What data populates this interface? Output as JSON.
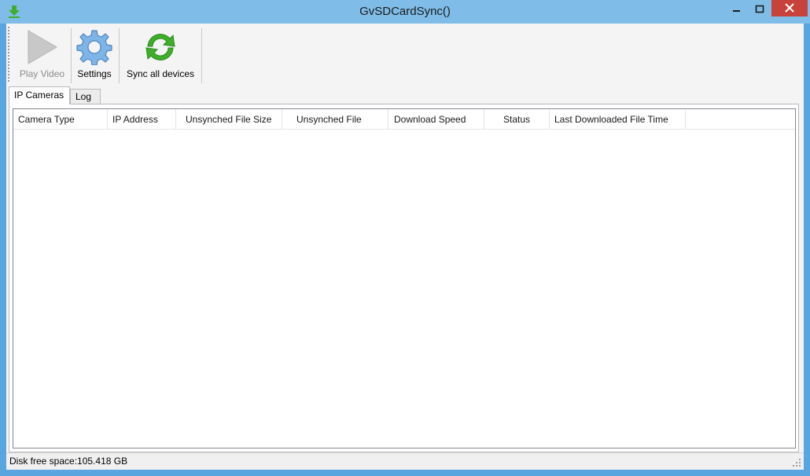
{
  "window": {
    "title": "GvSDCardSync()",
    "icon": "download-arrow-icon"
  },
  "toolbar": {
    "buttons": [
      {
        "label": "Play Video",
        "icon": "play-icon",
        "enabled": false
      },
      {
        "label": "Settings",
        "icon": "gear-icon",
        "enabled": true
      },
      {
        "label": "Sync all devices",
        "icon": "sync-arrows-icon",
        "enabled": true
      }
    ]
  },
  "tabs": [
    {
      "label": "IP Cameras",
      "selected": true
    },
    {
      "label": "Log",
      "selected": false
    }
  ],
  "table": {
    "columns": [
      "Camera Type",
      "IP Address",
      "Unsynched File Size",
      "Unsynched File",
      "Download Speed",
      "Status",
      "Last Downloaded File Time"
    ],
    "rows": []
  },
  "statusbar": {
    "text": "Disk free space:105.418 GB"
  },
  "colors": {
    "frame": "#59a5e0",
    "titlebar": "#7fbde8",
    "close_button": "#c8413a",
    "sync_green": "#3fae2a"
  }
}
